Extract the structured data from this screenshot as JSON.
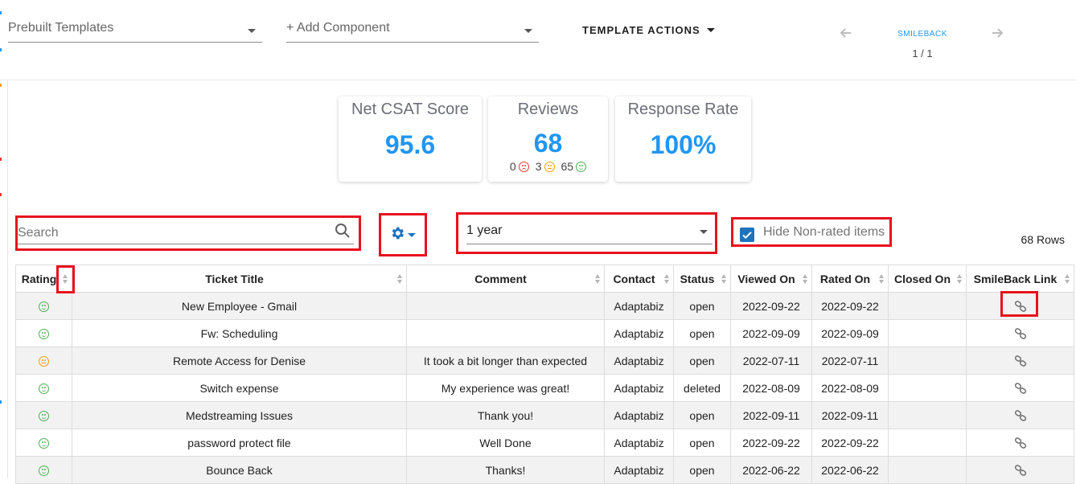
{
  "toolbar": {
    "prebuilt_templates": "Prebuilt Templates",
    "add_component": "+ Add Component",
    "template_actions": "TEMPLATE ACTIONS",
    "pager_title": "SMILEBACK",
    "pager_count": "1 / 1"
  },
  "cards": [
    {
      "label": "Net CSAT Score",
      "value": "95.6"
    },
    {
      "label": "Reviews",
      "value": "68",
      "negative": "0",
      "neutral": "3",
      "positive": "65"
    },
    {
      "label": "Response Rate",
      "value": "100%"
    }
  ],
  "filters": {
    "search_placeholder": "Search",
    "period": "1 year",
    "hide_nonrated_label": "Hide Non-rated items",
    "hide_nonrated_checked": true,
    "rows_count": "68 Rows"
  },
  "table": {
    "columns": [
      "Rating",
      "Ticket Title",
      "Comment",
      "Contact",
      "Status",
      "Viewed On",
      "Rated On",
      "Closed On",
      "SmileBack Link"
    ],
    "rows": [
      {
        "rating": "positive",
        "title": "New Employee - Gmail",
        "comment": "",
        "contact": "Adaptabiz",
        "status": "open",
        "viewed": "2022-09-22",
        "rated": "2022-09-22",
        "closed": ""
      },
      {
        "rating": "positive",
        "title": "Fw: Scheduling",
        "comment": "",
        "contact": "Adaptabiz",
        "status": "open",
        "viewed": "2022-09-09",
        "rated": "2022-09-09",
        "closed": ""
      },
      {
        "rating": "neutral",
        "title": "Remote Access for Denise",
        "comment": "It took a bit longer than expected",
        "contact": "Adaptabiz",
        "status": "open",
        "viewed": "2022-07-11",
        "rated": "2022-07-11",
        "closed": ""
      },
      {
        "rating": "positive",
        "title": "Switch expense",
        "comment": "My experience was great!",
        "contact": "Adaptabiz",
        "status": "deleted",
        "viewed": "2022-08-09",
        "rated": "2022-08-09",
        "closed": ""
      },
      {
        "rating": "positive",
        "title": "Medstreaming Issues",
        "comment": "Thank you!",
        "contact": "Adaptabiz",
        "status": "open",
        "viewed": "2022-09-11",
        "rated": "2022-09-11",
        "closed": ""
      },
      {
        "rating": "positive",
        "title": "password protect file",
        "comment": "Well Done",
        "contact": "Adaptabiz",
        "status": "open",
        "viewed": "2022-09-22",
        "rated": "2022-09-22",
        "closed": ""
      },
      {
        "rating": "positive",
        "title": "Bounce Back",
        "comment": "Thanks!",
        "contact": "Adaptabiz",
        "status": "open",
        "viewed": "2022-06-22",
        "rated": "2022-06-22",
        "closed": ""
      }
    ]
  },
  "colors": {
    "accent": "#2196f3",
    "highlight_box": "#e8121d",
    "positive": "#4caf50",
    "neutral": "#f39c12",
    "negative": "#e53935"
  }
}
